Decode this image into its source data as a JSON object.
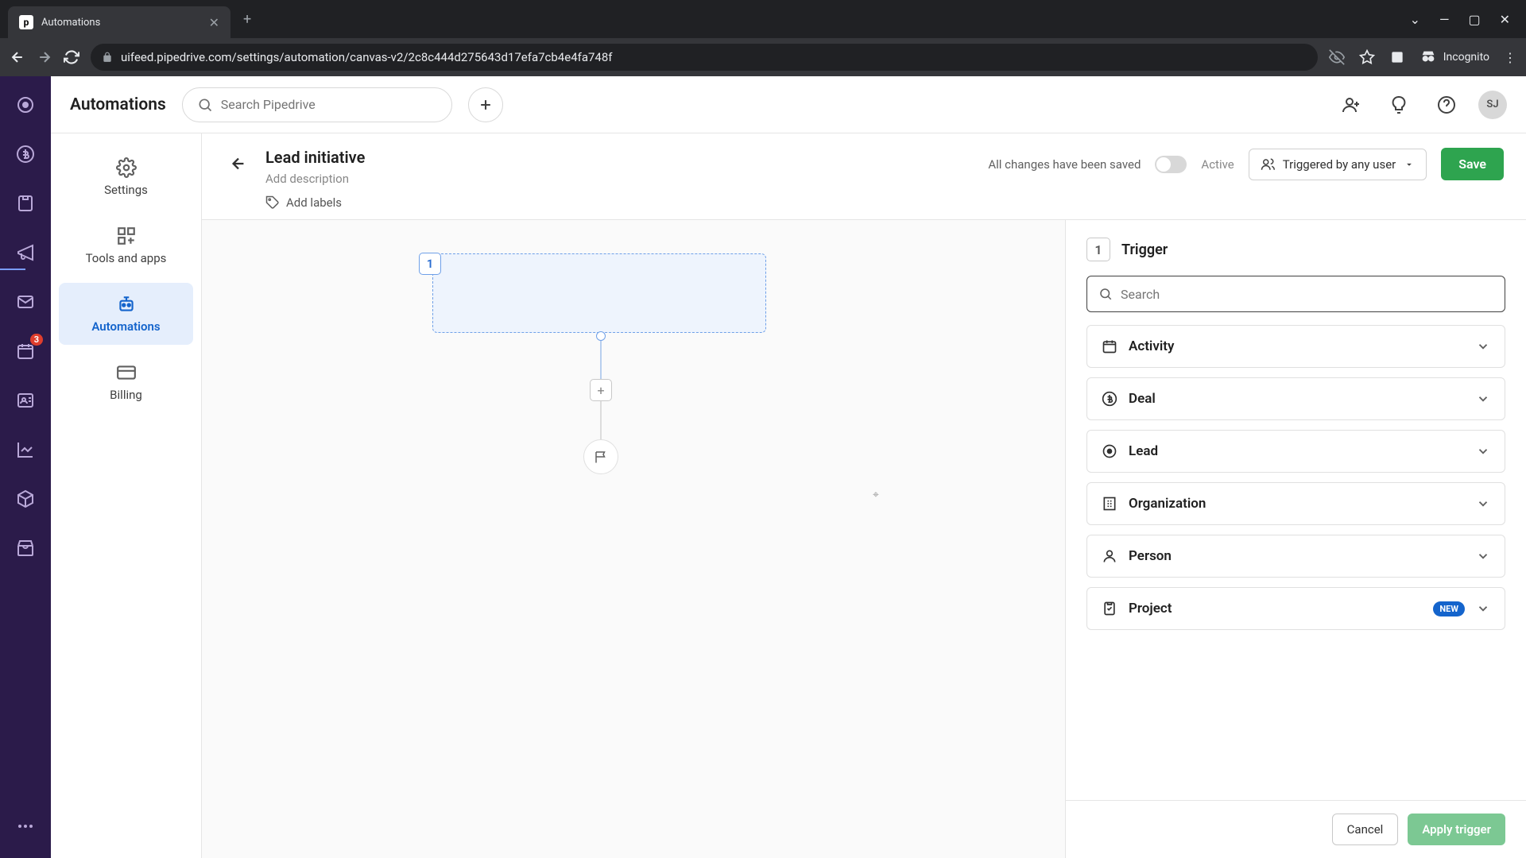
{
  "browser": {
    "tab_title": "Automations",
    "url": "uifeed.pipedrive.com/settings/automation/canvas-v2/2c8c444d275643d17efa7cb4e4fa748f",
    "incognito": "Incognito"
  },
  "rail": {
    "badge": "3"
  },
  "topbar": {
    "title": "Automations",
    "search_placeholder": "Search Pipedrive",
    "avatar": "SJ"
  },
  "sidepanel": {
    "settings": "Settings",
    "tools": "Tools and apps",
    "automations": "Automations",
    "billing": "Billing"
  },
  "header": {
    "name": "Lead initiative",
    "add_desc": "Add description",
    "add_labels": "Add labels",
    "saved": "All changes have been saved",
    "active": "Active",
    "triggered_by": "Triggered by any user",
    "save": "Save"
  },
  "canvas": {
    "node1": "1"
  },
  "panel": {
    "step_num": "1",
    "step_title": "Trigger",
    "search_placeholder": "Search",
    "categories": {
      "activity": "Activity",
      "deal": "Deal",
      "lead": "Lead",
      "organization": "Organization",
      "person": "Person",
      "project": "Project",
      "new_badge": "NEW"
    },
    "cancel": "Cancel",
    "apply": "Apply trigger"
  }
}
